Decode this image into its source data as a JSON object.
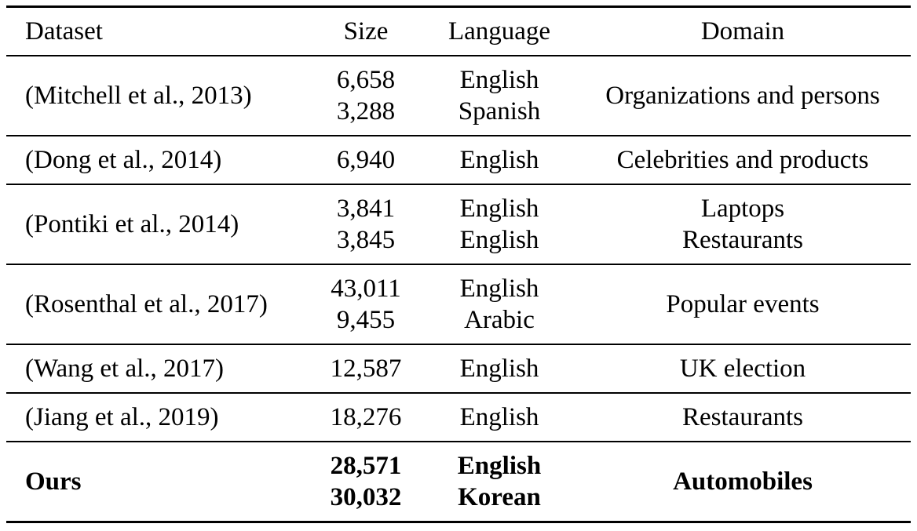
{
  "table": {
    "headers": {
      "dataset": "Dataset",
      "size": "Size",
      "language": "Language",
      "domain": "Domain"
    },
    "rows": [
      {
        "dataset": "(Mitchell et al., 2013)",
        "sizes": [
          "6,658",
          "3,288"
        ],
        "languages": [
          "English",
          "Spanish"
        ],
        "domain": "Organizations and persons",
        "bold": false
      },
      {
        "dataset": "(Dong et al., 2014)",
        "sizes": [
          "6,940"
        ],
        "languages": [
          "English"
        ],
        "domain": "Celebrities and products",
        "bold": false
      },
      {
        "dataset": "(Pontiki et al., 2014)",
        "sizes": [
          "3,841",
          "3,845"
        ],
        "languages": [
          "English",
          "English"
        ],
        "domain": "Laptops\nRestaurants",
        "domains": [
          "Laptops",
          "Restaurants"
        ],
        "bold": false
      },
      {
        "dataset": "(Rosenthal et al., 2017)",
        "sizes": [
          "43,011",
          "9,455"
        ],
        "languages": [
          "English",
          "Arabic"
        ],
        "domain": "Popular events",
        "bold": false
      },
      {
        "dataset": "(Wang et al., 2017)",
        "sizes": [
          "12,587"
        ],
        "languages": [
          "English"
        ],
        "domain": "UK election",
        "bold": false
      },
      {
        "dataset": "(Jiang et al., 2019)",
        "sizes": [
          "18,276"
        ],
        "languages": [
          "English"
        ],
        "domain": "Restaurants",
        "bold": false
      },
      {
        "dataset": "Ours",
        "sizes": [
          "28,571",
          "30,032"
        ],
        "languages": [
          "English",
          "Korean"
        ],
        "domain": "Automobiles",
        "bold": true
      }
    ]
  }
}
